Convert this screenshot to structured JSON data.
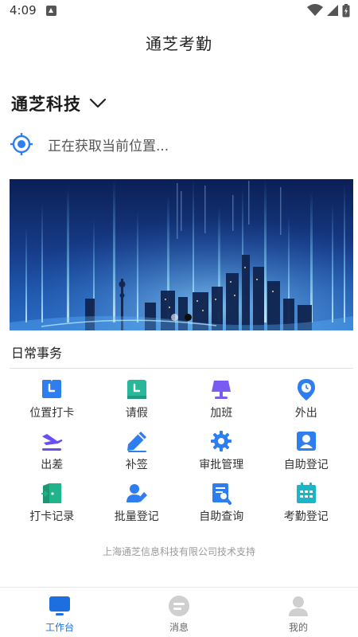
{
  "status_bar": {
    "time": "4:09"
  },
  "header": {
    "title": "通芝考勤"
  },
  "company": {
    "name": "通芝科技"
  },
  "location": {
    "text": "正在获取当前位置..."
  },
  "banner": {
    "slide_count": 2,
    "active_slide": 2
  },
  "daily": {
    "title": "日常事务",
    "items": [
      {
        "label": "位置打卡",
        "icon": "location-clock-icon",
        "color": "#2e7ef0"
      },
      {
        "label": "请假",
        "icon": "leave-calendar-icon",
        "color": "#29b79a"
      },
      {
        "label": "加班",
        "icon": "lamp-icon",
        "color": "#7a5cf0"
      },
      {
        "label": "外出",
        "icon": "map-pin-icon",
        "color": "#2e7ef0"
      },
      {
        "label": "出差",
        "icon": "plane-icon",
        "color": "#6a4ff0"
      },
      {
        "label": "补签",
        "icon": "pen-icon",
        "color": "#2e7ef0"
      },
      {
        "label": "审批管理",
        "icon": "gear-icon",
        "color": "#2e7ef0"
      },
      {
        "label": "自助登记",
        "icon": "person-card-icon",
        "color": "#2e7ef0"
      },
      {
        "label": "打卡记录",
        "icon": "door-exit-icon",
        "color": "#21b38a"
      },
      {
        "label": "批量登记",
        "icon": "user-edit-icon",
        "color": "#2e7ef0"
      },
      {
        "label": "自助查询",
        "icon": "document-search-icon",
        "color": "#2e7ef0"
      },
      {
        "label": "考勤登记",
        "icon": "calendar-grid-icon",
        "color": "#1bb5c9"
      }
    ]
  },
  "footer": {
    "text": "上海通芝信息科技有限公司技术支持"
  },
  "nav": {
    "items": [
      {
        "label": "工作台",
        "icon": "workbench-icon",
        "active": true
      },
      {
        "label": "消息",
        "icon": "message-icon",
        "active": false
      },
      {
        "label": "我的",
        "icon": "profile-icon",
        "active": false
      }
    ]
  },
  "colors": {
    "accent": "#1d6fe0",
    "inactive": "#cfcfcf"
  }
}
